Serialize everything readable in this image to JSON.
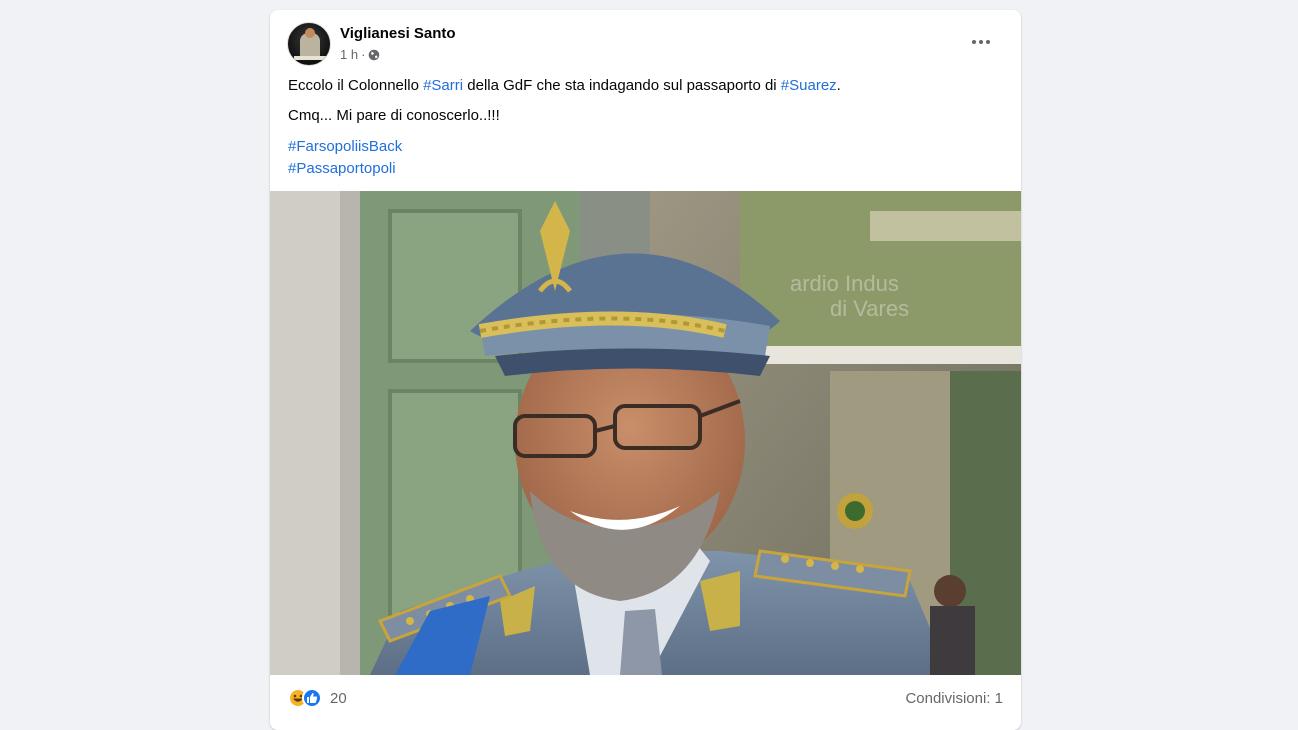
{
  "post": {
    "author": "Viglianesi Santo",
    "time": "1 h",
    "body": {
      "line1_prefix": "Eccolo il Colonnello ",
      "line1_tag1": "#Sarri",
      "line1_middle": " della GdF che sta indagando sul passaporto di ",
      "line1_tag2": "#Suarez",
      "line1_suffix": ".",
      "line2": "Cmq... Mi pare di conoscerlo..!!!"
    },
    "hashtags": [
      "#FarsopoliisBack",
      "#Passaportopoli"
    ],
    "reactions": {
      "icons": [
        "haha-icon",
        "like-icon"
      ],
      "count": "20"
    },
    "shares": "Condivisioni: 1"
  },
  "colors": {
    "background": "#f0f2f5",
    "link": "#216fdb",
    "secondary_text": "#65676b",
    "like_blue": "#1877f2",
    "haha_yellow": "#f7b125"
  }
}
